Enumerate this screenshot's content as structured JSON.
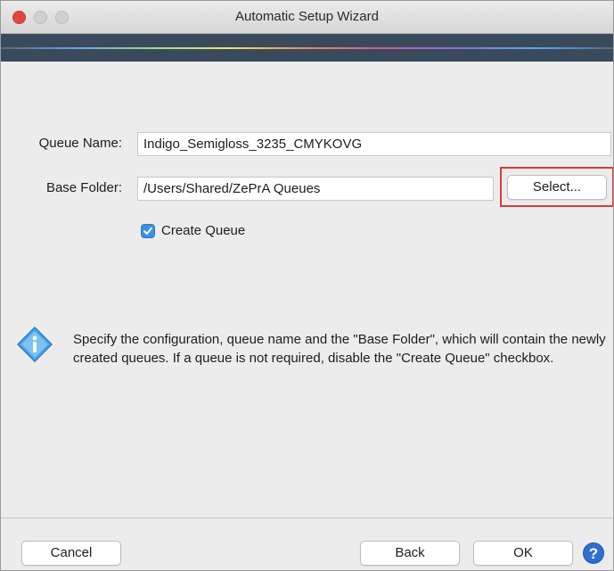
{
  "window": {
    "title": "Automatic Setup Wizard"
  },
  "form": {
    "queue_name_label": "Queue Name:",
    "queue_name_value": "Indigo_Semigloss_3235_CMYKOVG",
    "base_folder_label": "Base Folder:",
    "base_folder_value": "/Users/Shared/ZePrA Queues",
    "select_button": "Select...",
    "create_queue_label": "Create Queue",
    "create_queue_checked": true
  },
  "info": {
    "icon": "info-icon",
    "text": "Specify the configuration, queue name and the \"Base Folder\", which will contain the newly created queues. If a queue is not required, disable the \"Create Queue\" checkbox."
  },
  "footer": {
    "cancel_label": "Cancel",
    "back_label": "Back",
    "ok_label": "OK",
    "help_label": "?"
  },
  "colors": {
    "highlight": "#d93b3b",
    "checkbox": "#3d8fe0",
    "banner": "#3a4a5d"
  }
}
